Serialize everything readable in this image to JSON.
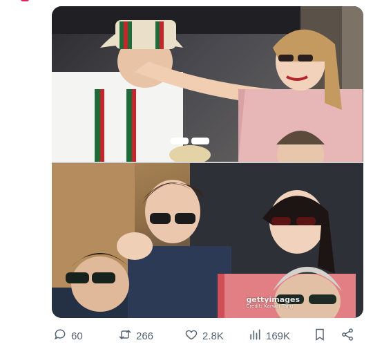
{
  "tweet": {
    "media": {
      "top_photo": {
        "alt_name": "top-photo"
      },
      "bottom_photo": {
        "watermark": {
          "logo": "gettyimages",
          "credit": "Credit: Karwai Tang"
        }
      }
    },
    "actions": {
      "reply": {
        "icon": "reply-icon",
        "count": "60"
      },
      "retweet": {
        "icon": "retweet-icon",
        "count": "266"
      },
      "like": {
        "icon": "heart-icon",
        "count": "2.8K"
      },
      "views": {
        "icon": "views-icon",
        "count": "169K"
      },
      "bookmark": {
        "icon": "bookmark-icon"
      },
      "share": {
        "icon": "share-icon"
      }
    },
    "colors": {
      "action_gray": "#536471",
      "accent": "#e0245e"
    }
  }
}
